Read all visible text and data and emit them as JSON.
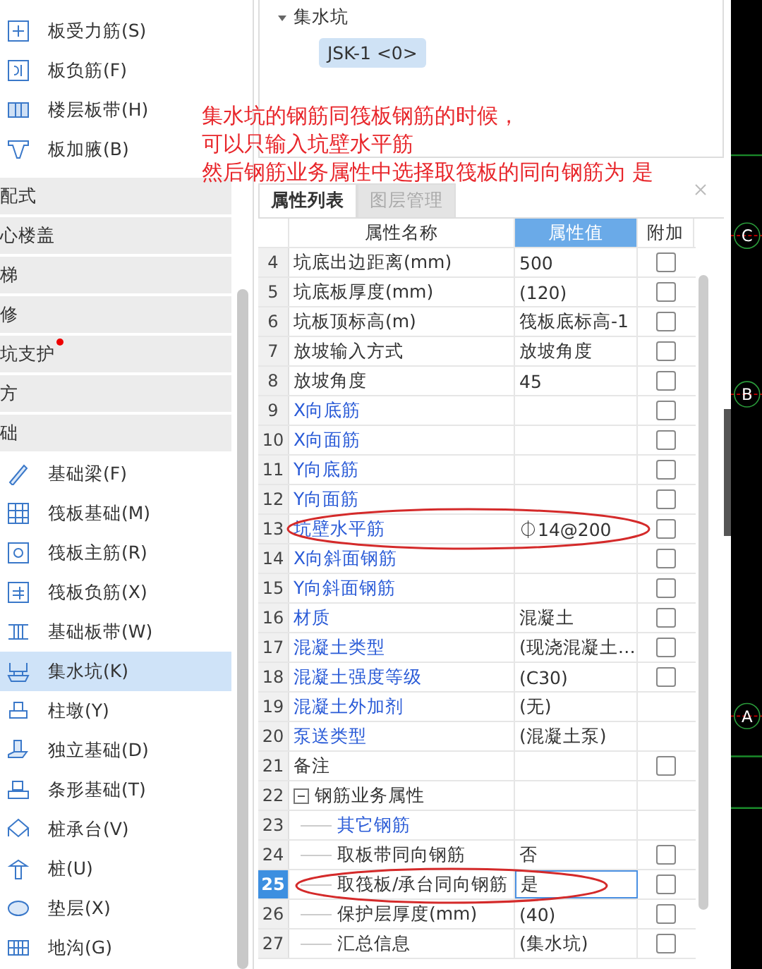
{
  "tree": {
    "group": {
      "label": "集水坑",
      "expanded": true
    },
    "items": [
      {
        "label": "JSK-1 <0>",
        "selected": true
      }
    ]
  },
  "sidebar": {
    "top_items": [
      {
        "label": "板受力筋(S)",
        "selected": false
      },
      {
        "label": "板负筋(F)",
        "selected": false
      },
      {
        "label": "楼层板带(H)",
        "selected": false
      },
      {
        "label": "板加腋(B)",
        "selected": false
      }
    ],
    "categories": [
      {
        "label": "配式",
        "has_notice": false
      },
      {
        "label": "心楼盖",
        "has_notice": false
      },
      {
        "label": "梯",
        "has_notice": false
      },
      {
        "label": "修",
        "has_notice": false
      },
      {
        "label": "坑支护",
        "has_notice": true
      },
      {
        "label": "方",
        "has_notice": false
      },
      {
        "label": "础",
        "has_notice": false
      }
    ],
    "items": [
      {
        "label": "基础梁(F)",
        "selected": false
      },
      {
        "label": "筏板基础(M)",
        "selected": false
      },
      {
        "label": "筏板主筋(R)",
        "selected": false
      },
      {
        "label": "筏板负筋(X)",
        "selected": false
      },
      {
        "label": "基础板带(W)",
        "selected": false
      },
      {
        "label": "集水坑(K)",
        "selected": true
      },
      {
        "label": "柱墩(Y)",
        "selected": false
      },
      {
        "label": "独立基础(D)",
        "selected": false
      },
      {
        "label": "条形基础(T)",
        "selected": false
      },
      {
        "label": "桩承台(V)",
        "selected": false
      },
      {
        "label": "桩(U)",
        "selected": false
      },
      {
        "label": "垫层(X)",
        "selected": false
      },
      {
        "label": "地沟(G)",
        "selected": false
      }
    ]
  },
  "annotation": {
    "lines": [
      "集水坑的钢筋同筏板钢筋的时候，",
      "可以只输入坑壁水平筋",
      "然后钢筋业务属性中选择取筏板的同向钢筋为 是"
    ]
  },
  "properties": {
    "tabs": [
      {
        "label": "属性列表",
        "selected": true
      },
      {
        "label": "图层管理",
        "selected": false
      }
    ],
    "columns": [
      "属性名称",
      "属性值",
      "附加"
    ],
    "rows": [
      {
        "no": "4",
        "name": "坑底出边距离(mm)",
        "value": "500",
        "kind": "private",
        "checked": false,
        "selected": false
      },
      {
        "no": "5",
        "name": "坑底板厚度(mm)",
        "value": "(120)",
        "kind": "private",
        "checked": false,
        "selected": false
      },
      {
        "no": "6",
        "name": "坑板顶标高(m)",
        "value": "筏板底标高-1",
        "kind": "private",
        "checked": false,
        "selected": false
      },
      {
        "no": "7",
        "name": "放坡输入方式",
        "value": "放坡角度",
        "kind": "private",
        "checked": false,
        "selected": false
      },
      {
        "no": "8",
        "name": "放坡角度",
        "value": "45",
        "kind": "private",
        "checked": false,
        "selected": false
      },
      {
        "no": "9",
        "name": "X向底筋",
        "kind": "public",
        "checked": false,
        "selected": false
      },
      {
        "no": "10",
        "name": "X向面筋",
        "kind": "public",
        "checked": false,
        "selected": false
      },
      {
        "no": "11",
        "name": "Y向底筋",
        "kind": "public",
        "checked": false,
        "selected": false
      },
      {
        "no": "12",
        "name": "Y向面筋",
        "kind": "public",
        "checked": false,
        "selected": false
      },
      {
        "no": "13",
        "name": "坑壁水平筋",
        "value": "⏀14@200",
        "kind": "public",
        "checked": false,
        "selected": false
      },
      {
        "no": "14",
        "name": "X向斜面钢筋",
        "kind": "public",
        "checked": false,
        "selected": false
      },
      {
        "no": "15",
        "name": "Y向斜面钢筋",
        "kind": "public",
        "checked": false,
        "selected": false
      },
      {
        "no": "16",
        "name": "材质",
        "value": "混凝土",
        "kind": "public",
        "checked": false,
        "selected": false
      },
      {
        "no": "17",
        "name": "混凝土类型",
        "value": "(现浇混凝土…",
        "kind": "public",
        "checked": false,
        "selected": false
      },
      {
        "no": "18",
        "name": "混凝土强度等级",
        "value": "(C30)",
        "kind": "public",
        "checked": false,
        "selected": false
      },
      {
        "no": "19",
        "name": "混凝土外加剂",
        "value": "(无)",
        "kind": "public",
        "selected": false
      },
      {
        "no": "20",
        "name": "泵送类型",
        "value": "(混凝土泵)",
        "kind": "public",
        "selected": false
      },
      {
        "no": "21",
        "name": "备注",
        "kind": "private",
        "checked": false,
        "selected": false
      },
      {
        "no": "22",
        "name": "钢筋业务属性",
        "kind": "group",
        "expanded": true,
        "selected": false,
        "children": [
          {
            "no": "23",
            "name": "其它钢筋",
            "kind": "public",
            "selected": false
          },
          {
            "no": "24",
            "name": "取板带同向钢筋",
            "value": "否",
            "kind": "private",
            "checked": false,
            "selected": false
          },
          {
            "no": "25",
            "name": "取筏板/承台同向钢筋",
            "value": "是",
            "kind": "private",
            "checked": false,
            "selected": true
          },
          {
            "no": "26",
            "name": "保护层厚度(mm)",
            "value": "(40)",
            "kind": "private",
            "checked": false,
            "selected": false
          },
          {
            "no": "27",
            "name": "汇总信息",
            "value": "(集水坑)",
            "kind": "private",
            "checked": false,
            "selected": false
          }
        ]
      }
    ]
  },
  "canvas": {
    "axes": [
      "C",
      "B",
      "A"
    ]
  }
}
